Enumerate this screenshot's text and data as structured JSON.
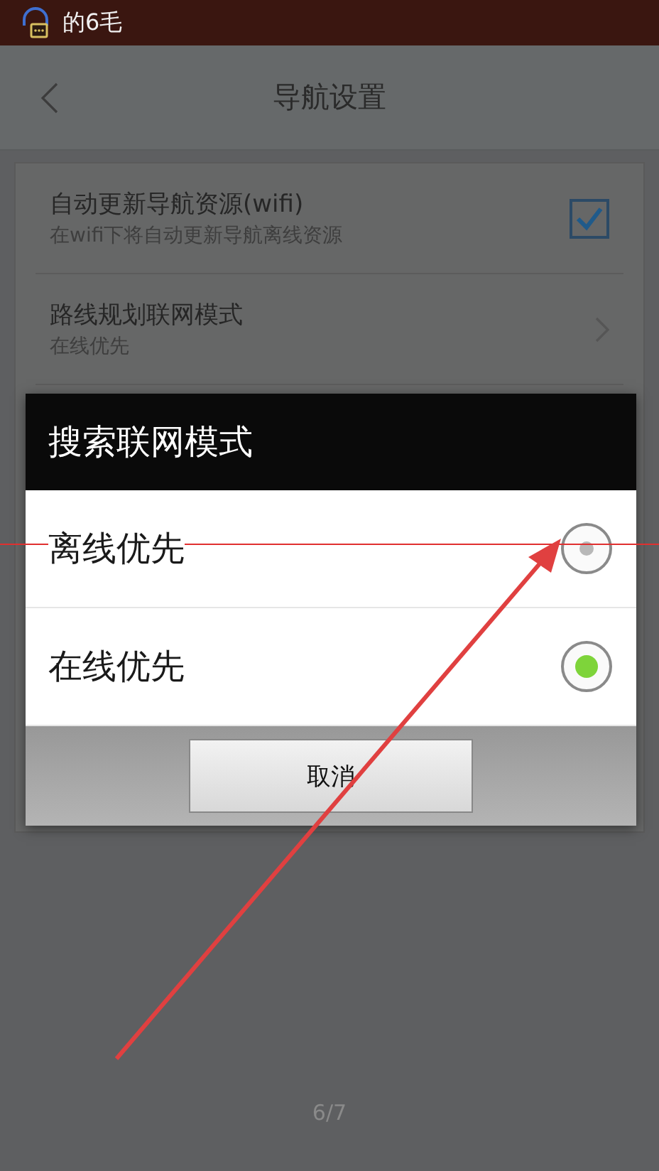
{
  "status_bar": {
    "text": "的6毛"
  },
  "header": {
    "title": "导航设置"
  },
  "settings": [
    {
      "kind": "checkbox",
      "title": "自动更新导航资源(wifi)",
      "subtitle": "在wifi下将自动更新导航离线资源",
      "checked": true
    },
    {
      "kind": "chevron",
      "title": "路线规划联网模式",
      "subtitle": "在线优先"
    }
  ],
  "dialog": {
    "title": "搜索联网模式",
    "options": [
      {
        "label": "离线优先",
        "selected": false
      },
      {
        "label": "在线优先",
        "selected": true
      }
    ],
    "buttons": [
      "取消"
    ]
  },
  "page_indicator": "6/7"
}
